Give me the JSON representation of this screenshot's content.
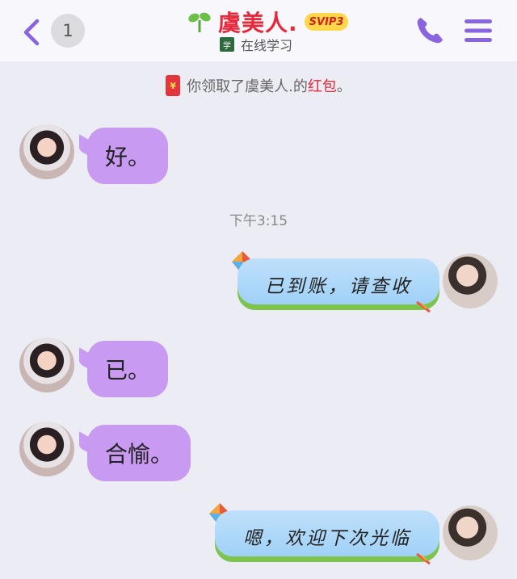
{
  "header": {
    "unread_count": "1",
    "title": "虞美人.",
    "vip_badge": "SVIP3",
    "status_icon_text": "学",
    "status_text": "在线学习"
  },
  "notice": {
    "prefix": "你领取了虞美人.的",
    "link": "红包",
    "suffix": "。"
  },
  "timestamp": "下午3:15",
  "messages": [
    {
      "side": "in",
      "text": "好。"
    },
    {
      "side": "out",
      "text": "已到账，请查收"
    },
    {
      "side": "in",
      "text": "已。"
    },
    {
      "side": "in",
      "text": "合愉。"
    },
    {
      "side": "out",
      "text": "嗯，欢迎下次光临"
    }
  ],
  "colors": {
    "accent": "#8a64e0",
    "title": "#e8283a",
    "incoming_bubble": "#c99af2",
    "outgoing_bubble": "#a8d6f8",
    "background": "#ececf4"
  },
  "icons": [
    "back-chevron-icon",
    "sprout-icon",
    "study-icon",
    "red-envelope-icon",
    "phone-icon",
    "menu-icon",
    "kite-icon"
  ]
}
